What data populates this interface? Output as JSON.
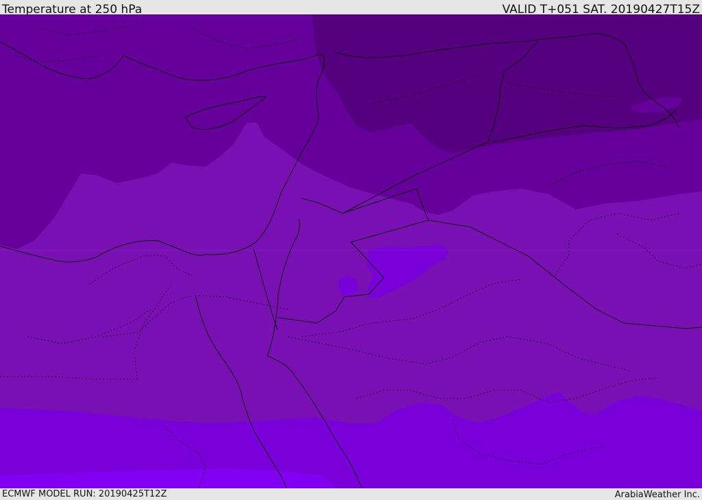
{
  "header": {
    "title": "Temperature at 250 hPa",
    "valid_time": "VALID T+051 SAT. 20190427T15Z"
  },
  "footer": {
    "model_run": "ECMWF MODEL RUN: 20190425T12Z",
    "credit": "ArabiaWeather Inc."
  },
  "map": {
    "field": "temperature-250hPa",
    "colors": {
      "band_coldest": "#55007f",
      "band_cold": "#66009a",
      "band_mid": "#7810b4",
      "band_warm": "#7a00da",
      "band_warmest": "#8200f2",
      "border_line": "#111111"
    }
  }
}
